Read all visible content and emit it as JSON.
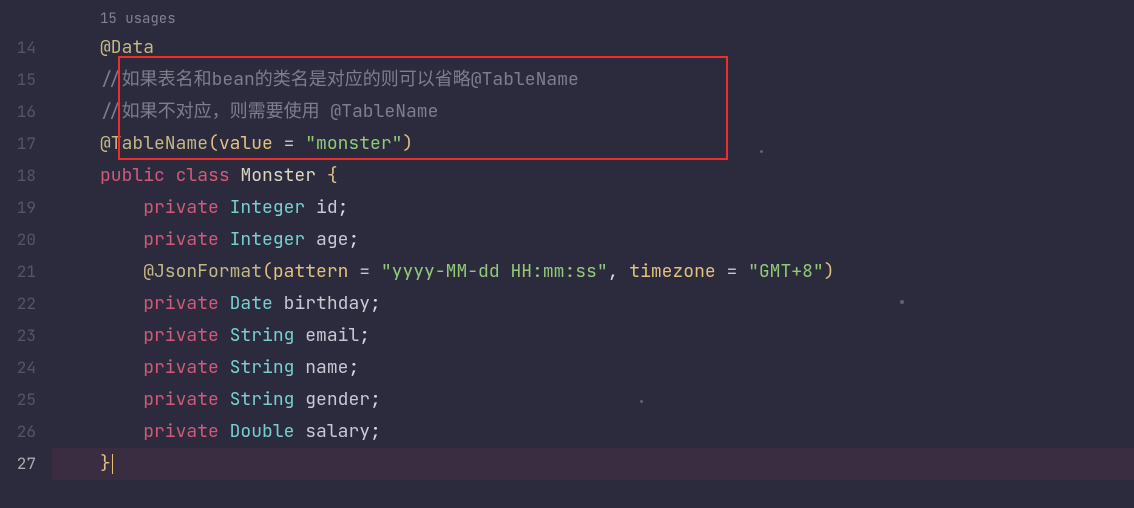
{
  "usages": "15 usages",
  "lines": {
    "14": "14",
    "15": "15",
    "16": "16",
    "17": "17",
    "18": "18",
    "19": "19",
    "20": "20",
    "21": "21",
    "22": "22",
    "23": "23",
    "24": "24",
    "25": "25",
    "26": "26",
    "27": "27"
  },
  "code": {
    "data_ann": "@Data",
    "comment1": "//如果表名和bean的类名是对应的则可以省略@TableName",
    "comment2": "//如果不对应，则需要使用 @TableName",
    "tablename_ann": "@TableName",
    "tablename_open": "(",
    "tablename_param": "value",
    "eq": " = ",
    "tablename_val": "\"monster\"",
    "tablename_close": ")",
    "kw_public": "public",
    "kw_class": "class",
    "class_name": "Monster",
    "brace_open": "{",
    "kw_private": "private",
    "type_integer": "Integer",
    "type_date": "Date",
    "type_string": "String",
    "type_double": "Double",
    "f_id": "id",
    "f_age": "age",
    "f_birthday": "birthday",
    "f_email": "email",
    "f_name": "name",
    "f_gender": "gender",
    "f_salary": "salary",
    "semi": ";",
    "jsonformat_ann": "@JsonFormat",
    "jf_open": "(",
    "jf_pattern_k": "pattern",
    "jf_pattern_v": "\"yyyy-MM-dd HH:mm:ss\"",
    "comma": ", ",
    "jf_tz_k": "timezone",
    "jf_tz_v": "\"GMT+8\"",
    "jf_close": ")",
    "brace_close": "}"
  }
}
